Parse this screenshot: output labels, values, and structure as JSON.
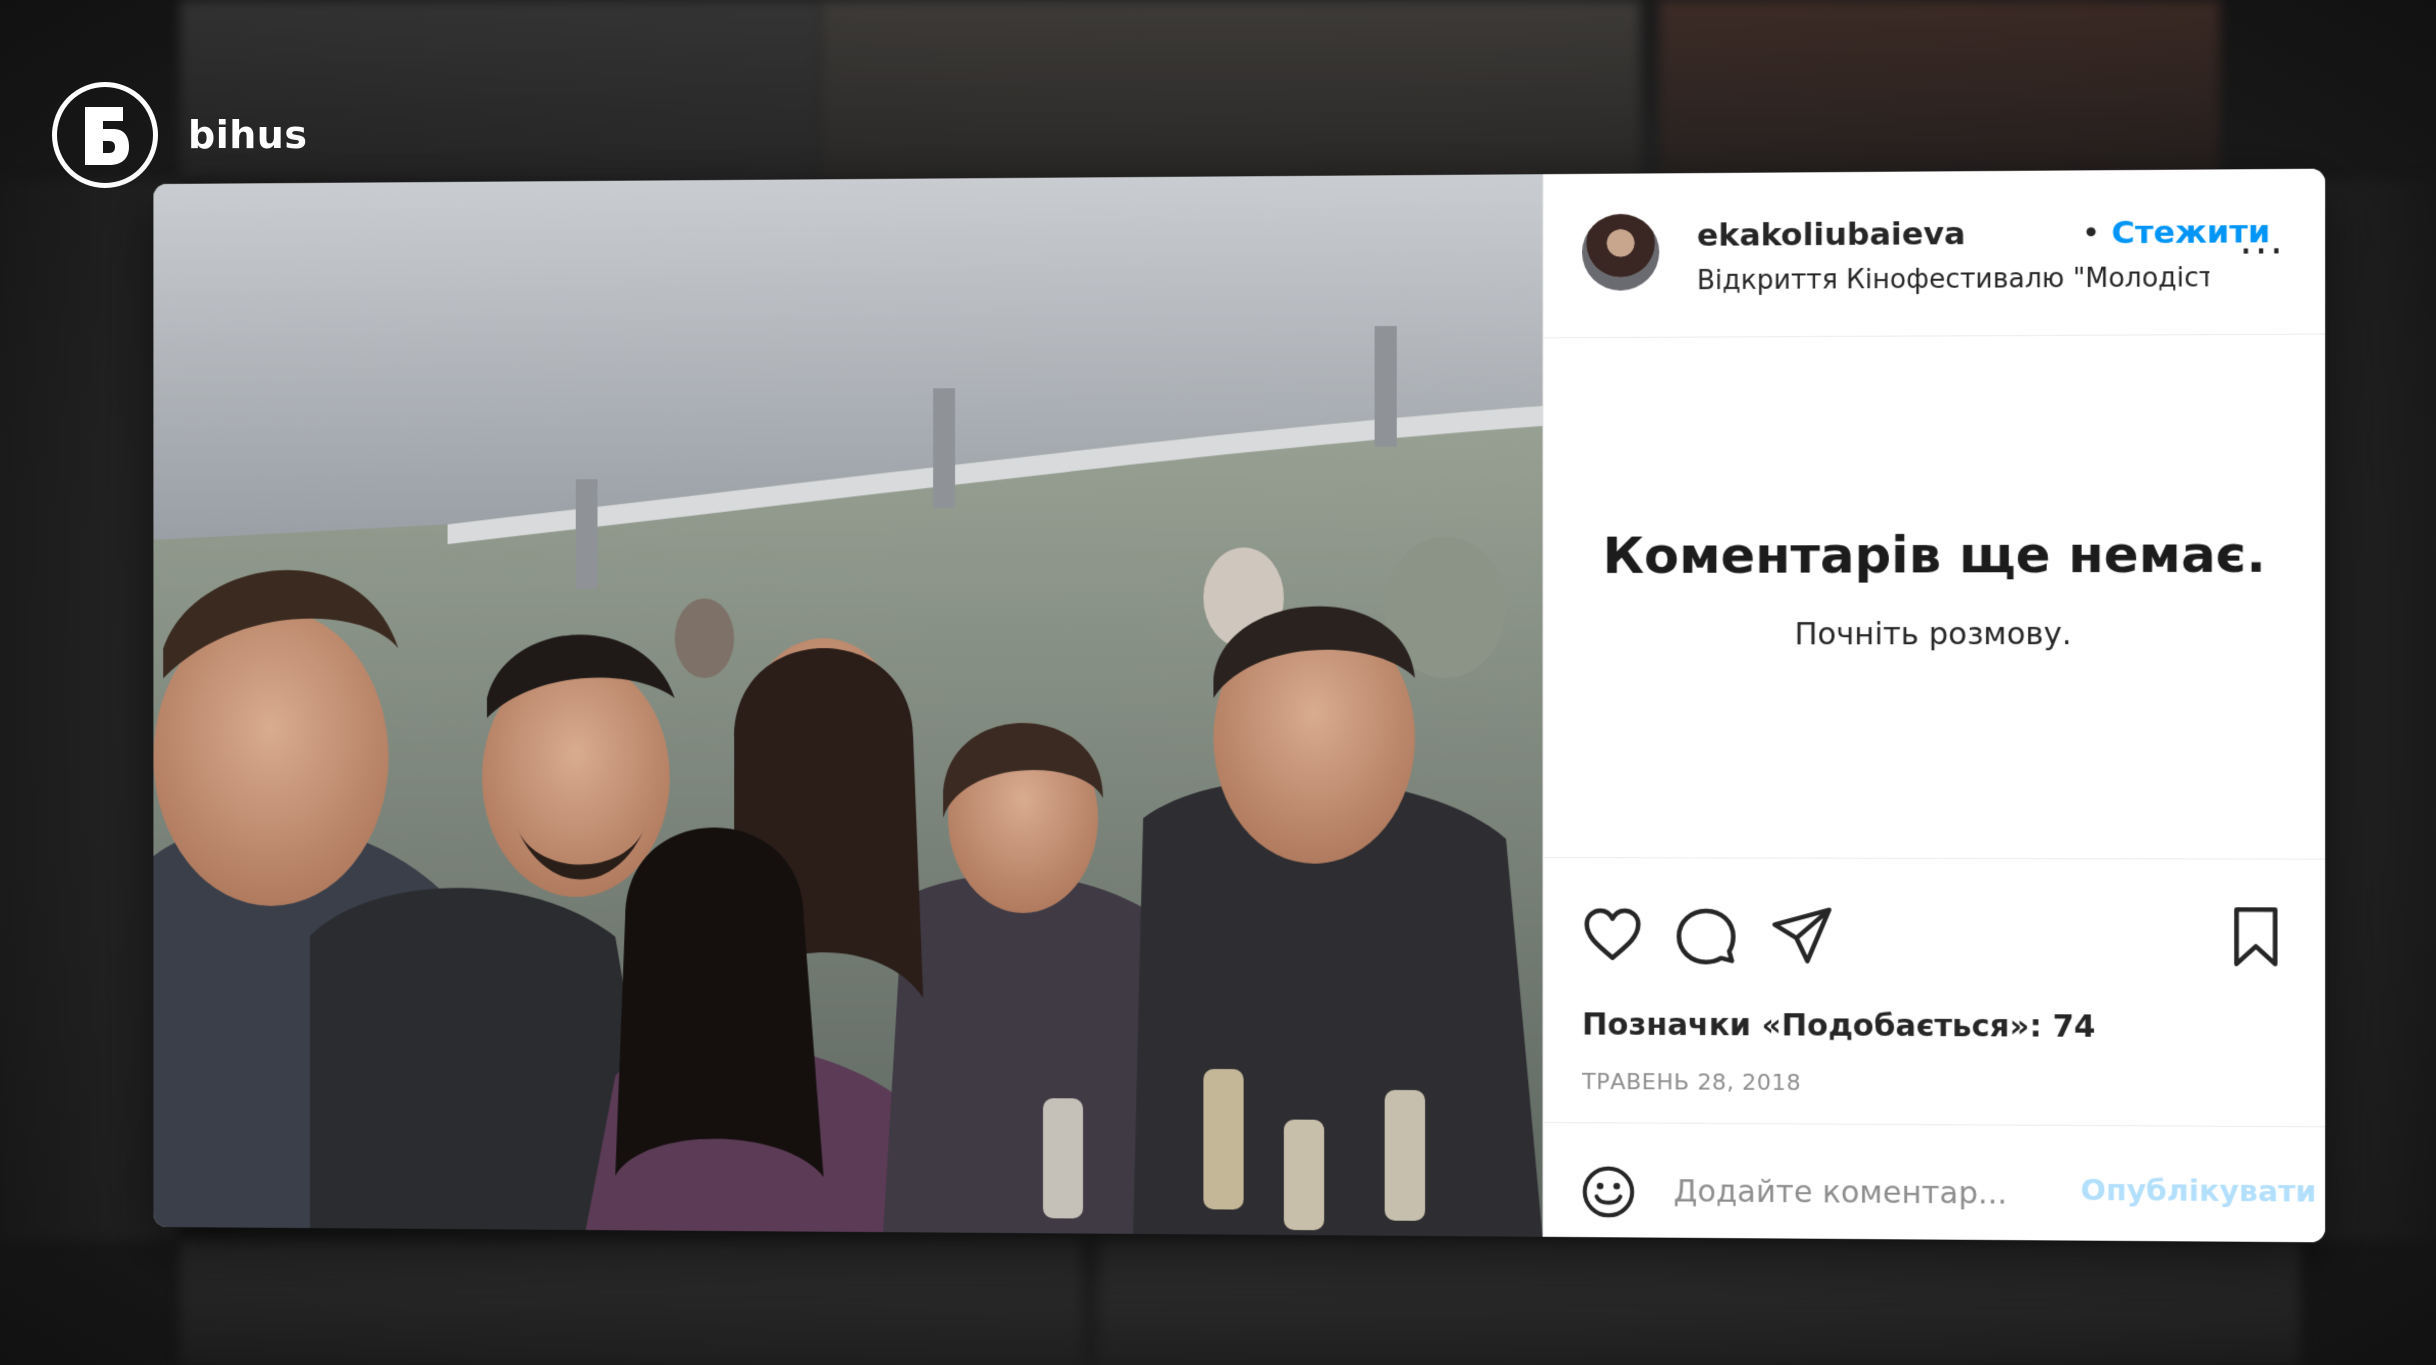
{
  "brand": {
    "name": "bihus",
    "logo_glyph": "б",
    "logo_icon": "bihus-logo-icon"
  },
  "post": {
    "photo_description_icon": "group-selfie-photo",
    "header": {
      "username": "ekakoliubaieva",
      "separator": "•",
      "follow_label": "Стежити",
      "location": "Відкриття Кінофестивалю \"Молодість...",
      "more_label": "..."
    },
    "comments": {
      "empty_title": "Коментарів ще немає.",
      "empty_subtitle": "Почніть розмову."
    },
    "actions": {
      "like_icon": "heart-icon",
      "comment_icon": "comment-icon",
      "share_icon": "share-icon",
      "save_icon": "bookmark-icon"
    },
    "likes_text": "Позначки «Подобається»: 74",
    "date_text": "ТРАВЕНЬ 28, 2018",
    "comment_box": {
      "placeholder": "Додайте коментар...",
      "publish_label": "Опублікувати"
    }
  },
  "colors": {
    "accent": "#0095f6",
    "publish_disabled": "#b2dffc",
    "text": "#262626",
    "muted": "#8e8e8e"
  }
}
